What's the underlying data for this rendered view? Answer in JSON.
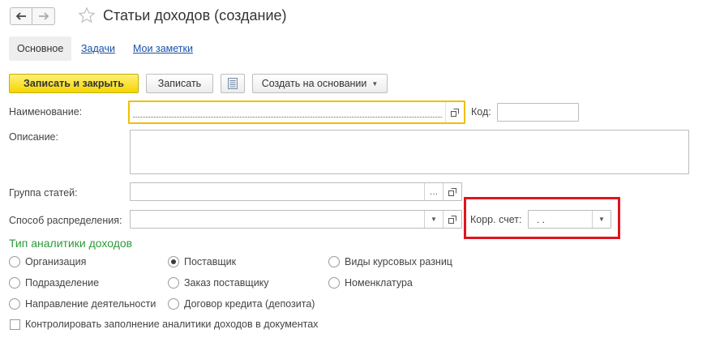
{
  "window": {
    "title": "Статьи доходов (создание)"
  },
  "tabs": [
    {
      "label": "Основное"
    },
    {
      "label": "Задачи"
    },
    {
      "label": "Мои заметки"
    }
  ],
  "toolbar": {
    "save_close_label": "Записать и закрыть",
    "save_label": "Записать",
    "create_based_label": "Создать на основании"
  },
  "form": {
    "name_label": "Наименование:",
    "name_value": "",
    "code_label": "Код:",
    "code_value": "",
    "description_label": "Описание:",
    "description_value": "",
    "group_label": "Группа статей:",
    "group_value": "",
    "distribution_label": "Способ распределения:",
    "distribution_value": "",
    "corr_account_label": "Корр. счет:",
    "corr_account_value": ".  ."
  },
  "analytics": {
    "section_title": "Тип аналитики доходов",
    "options": [
      {
        "label": "Организация",
        "checked": false
      },
      {
        "label": "Поставщик",
        "checked": true
      },
      {
        "label": "Виды курсовых разниц",
        "checked": false
      },
      {
        "label": "Подразделение",
        "checked": false
      },
      {
        "label": "Заказ поставщику",
        "checked": false
      },
      {
        "label": "Номенклатура",
        "checked": false
      },
      {
        "label": "Направление деятельности",
        "checked": false
      },
      {
        "label": "Договор кредита (депозита)",
        "checked": false
      }
    ],
    "control_checkbox_label": "Контролировать заполнение аналитики доходов в документах",
    "control_checked": false
  },
  "colors": {
    "primary_button": "#f5d600",
    "section_title": "#2e9a3a",
    "focus_border": "#f0c000",
    "highlight_box": "#e0141e",
    "link": "#1a50a8"
  }
}
